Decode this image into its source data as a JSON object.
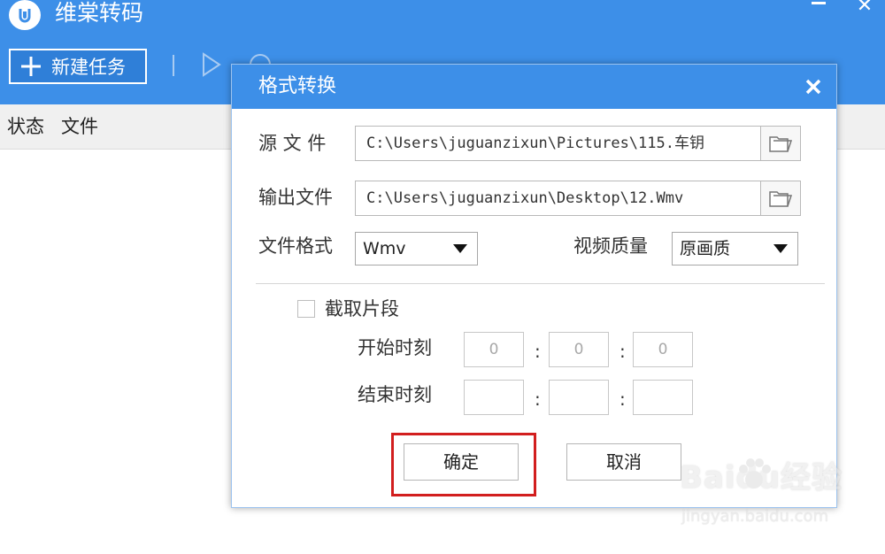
{
  "app": {
    "title": "维棠转码",
    "toolbar": {
      "new_task_label": "新建任务"
    },
    "columns": [
      "状态",
      "文件"
    ]
  },
  "dialog": {
    "title": "格式转换",
    "source": {
      "label": "源 文 件",
      "value": "C:\\Users\\juguanzixun\\Pictures\\115.车钥"
    },
    "output": {
      "label": "输出文件",
      "value": "C:\\Users\\juguanzixun\\Desktop\\12.Wmv"
    },
    "format": {
      "label": "文件格式",
      "selected": "Wmv"
    },
    "quality": {
      "label": "视频质量",
      "selected": "原画质"
    },
    "clip": {
      "label": "截取片段",
      "checked": false,
      "start_label": "开始时刻",
      "end_label": "结束时刻",
      "start": [
        "0",
        "0",
        "0"
      ],
      "end": [
        "",
        "",
        ""
      ],
      "separator": ":"
    },
    "buttons": {
      "ok": "确定",
      "cancel": "取消"
    }
  },
  "watermark": {
    "main": "Baidu经验",
    "sub": "jingyan.baidu.com"
  },
  "colors": {
    "accent": "#3d8fe8",
    "highlight": "#d21e1e"
  },
  "icons": [
    "app-logo-icon",
    "plus-icon",
    "play-icon",
    "stop-icon",
    "delete-icon",
    "minimize-icon",
    "close-icon",
    "folder-icon",
    "caret-down-icon",
    "paw-icon"
  ]
}
